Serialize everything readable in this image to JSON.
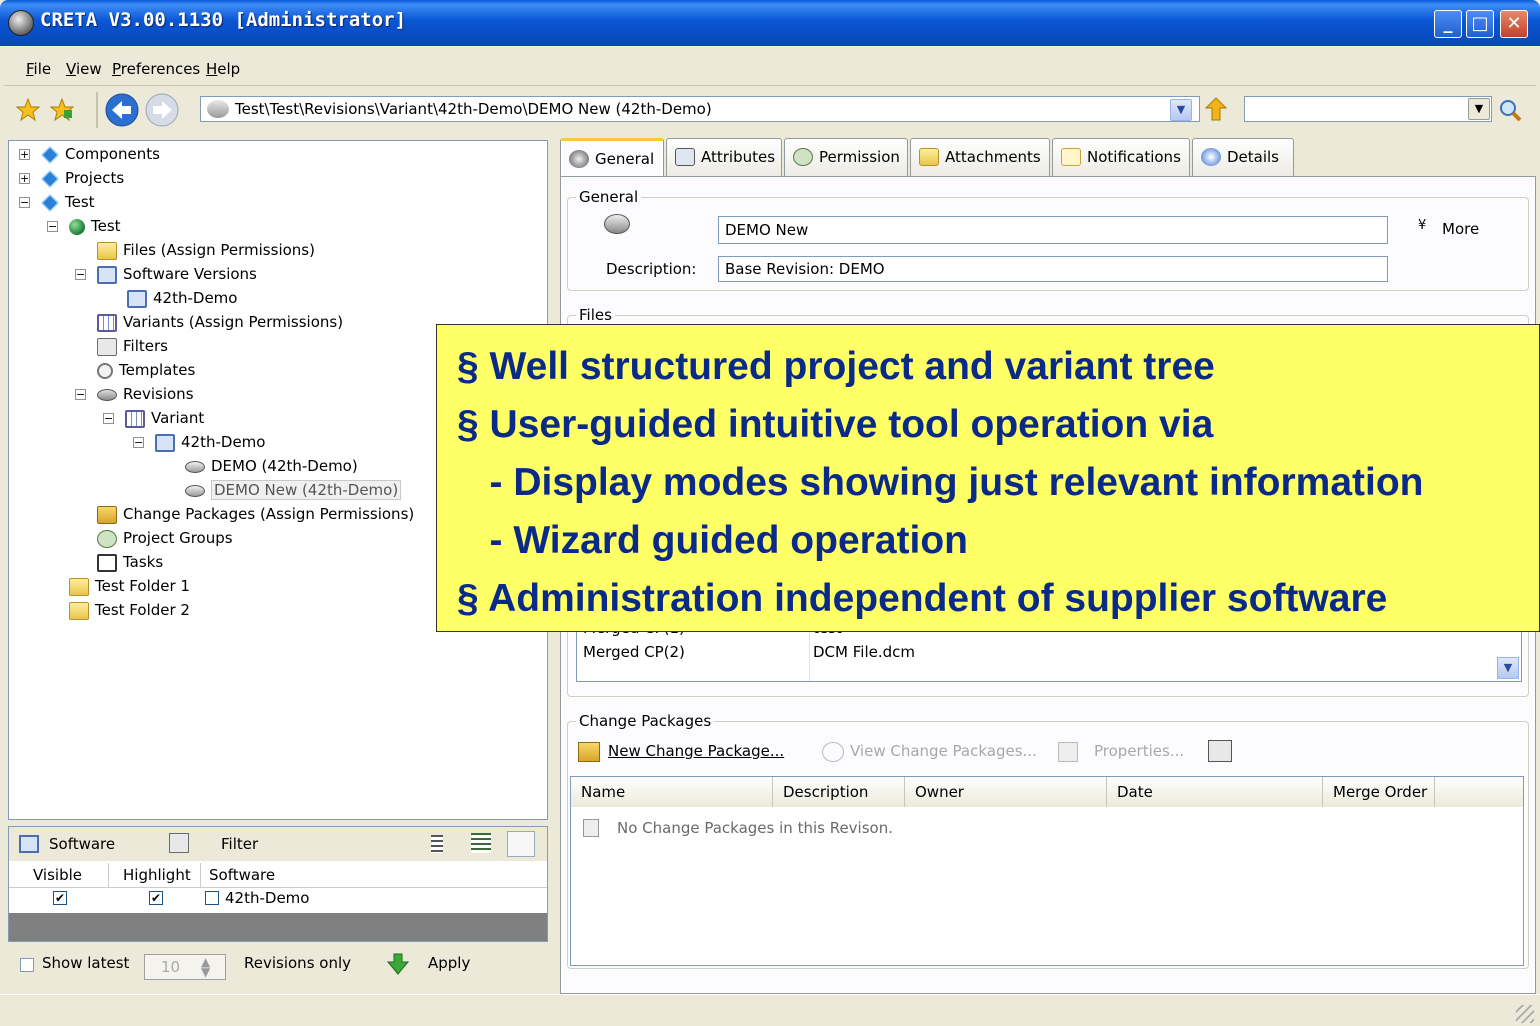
{
  "window": {
    "title": "CRETA V3.00.1130  [Administrator]"
  },
  "menu": [
    "File",
    "View",
    "Preferences",
    "Help"
  ],
  "toolbar": {
    "address": "Test\\Test\\Revisions\\Variant\\42th-Demo\\DEMO New (42th-Demo)",
    "search_value": ""
  },
  "tree": [
    {
      "label": "Components",
      "icon": "diamond-icon"
    },
    {
      "label": "Projects",
      "icon": "diamond-icon"
    },
    {
      "label": "Test",
      "icon": "diamond-icon"
    },
    {
      "label": "Test",
      "icon": "globe-icon"
    },
    {
      "label": "Files (Assign Permissions)",
      "icon": "folder-open-icon"
    },
    {
      "label": "Software Versions",
      "icon": "monitor-icon"
    },
    {
      "label": "42th-Demo",
      "icon": "monitor-icon"
    },
    {
      "label": "Variants (Assign Permissions)",
      "icon": "table-icon"
    },
    {
      "label": "Filters",
      "icon": "filter-icon"
    },
    {
      "label": "Templates",
      "icon": "template-icon"
    },
    {
      "label": "Revisions",
      "icon": "disk-icon"
    },
    {
      "label": "Variant",
      "icon": "table-icon"
    },
    {
      "label": "42th-Demo",
      "icon": "monitor-icon"
    },
    {
      "label": "DEMO (42th-Demo)",
      "icon": "disk-icon"
    },
    {
      "label": "DEMO New (42th-Demo)",
      "icon": "disk-lock-icon"
    },
    {
      "label": "Change Packages (Assign Permissions)",
      "icon": "package-icon"
    },
    {
      "label": "Project Groups",
      "icon": "group-icon"
    },
    {
      "label": "Tasks",
      "icon": "task-icon"
    },
    {
      "label": "Test Folder 1",
      "icon": "folder-open-icon"
    },
    {
      "label": "Test Folder 2",
      "icon": "folder-icon"
    }
  ],
  "sw_panel": {
    "tab_software": "Software",
    "tab_filter": "Filter",
    "columns": [
      "Visible",
      "Highlight",
      "Software"
    ],
    "rows": [
      {
        "visible": "✔",
        "highlight": "✔",
        "software": "42th-Demo"
      }
    ]
  },
  "bottom_left": {
    "show_latest": "Show latest",
    "latest_count": "10",
    "revisions_only": "Revisions only",
    "apply": "Apply"
  },
  "tabs": [
    "General",
    "Attributes",
    "Permission",
    "Attachments",
    "Notifications",
    "Details"
  ],
  "general": {
    "group_label": "General",
    "name_value": "DEMO New",
    "more_label": "More",
    "description_label": "Description:",
    "description_value": "Base Revision: DEMO"
  },
  "files": {
    "group_label": "Files",
    "rows": [
      {
        "name": "Merged CP(1)",
        "value": "test"
      },
      {
        "name": "Merged CP(2)",
        "value": "DCM File.dcm"
      }
    ]
  },
  "change_packages": {
    "group_label": "Change Packages",
    "new_label": "New Change Package...",
    "view_label": "View Change Packages...",
    "properties_label": "Properties...",
    "columns": [
      "Name",
      "Description",
      "Owner",
      "Date",
      "Merge Order"
    ],
    "empty_text": "No Change Packages in this Revison."
  },
  "overlay": {
    "lines": [
      "§ Well structured project and variant tree",
      "§ User-guided intuitive tool operation via",
      "   - Display modes showing just relevant information",
      "   - Wizard guided operation",
      "§ Administration independent of supplier software"
    ]
  },
  "colors": {
    "title_bar": "#0a56d4",
    "overlay_bg": "#ffff66",
    "overlay_text": "#0a2a8a"
  }
}
